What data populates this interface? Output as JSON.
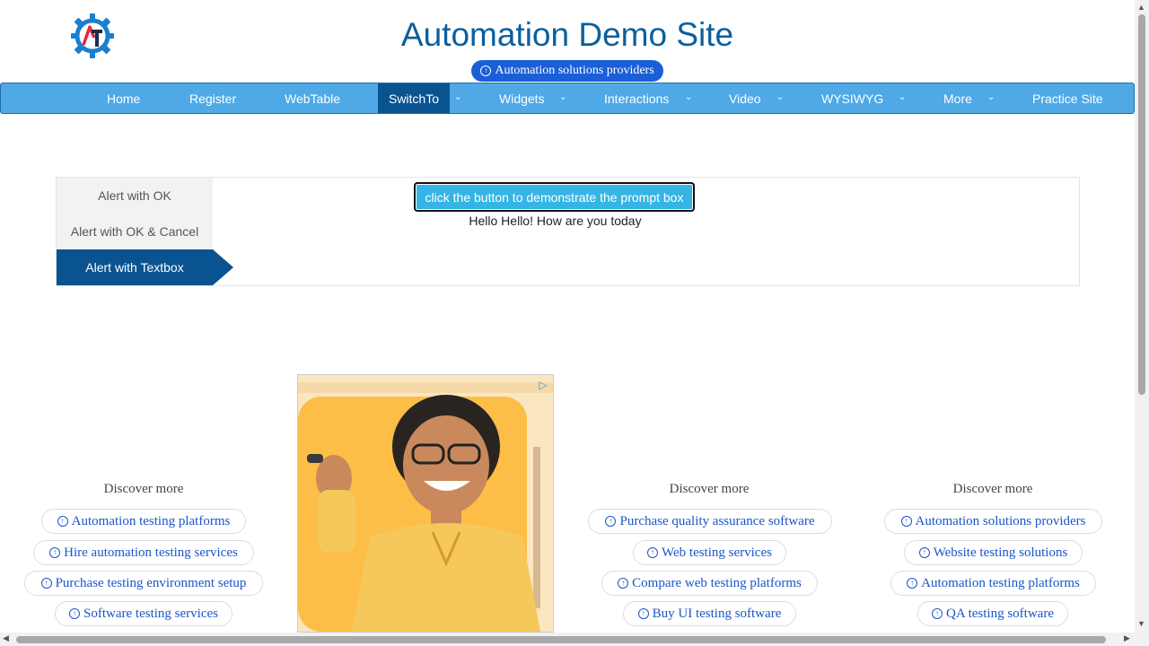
{
  "header": {
    "title": "Automation Demo Site",
    "promo": "Automation solutions providers"
  },
  "nav": {
    "items": [
      {
        "label": "Home"
      },
      {
        "label": "Register"
      },
      {
        "label": "WebTable"
      },
      {
        "label": "SwitchTo"
      },
      {
        "label": "Widgets"
      },
      {
        "label": "Interactions"
      },
      {
        "label": "Video"
      },
      {
        "label": "WYSIWYG"
      },
      {
        "label": "More"
      },
      {
        "label": "Practice Site"
      }
    ]
  },
  "alerts": {
    "tabs": [
      {
        "label": "Alert with OK"
      },
      {
        "label": "Alert with OK & Cancel"
      },
      {
        "label": "Alert with Textbox"
      }
    ],
    "button_label": "click the button to demonstrate the prompt box",
    "result": "Hello Hello! How are you today"
  },
  "discover": [
    {
      "title": "Discover more",
      "links": [
        "Automation testing platforms",
        "Hire automation testing services",
        "Purchase testing environment setup",
        "Software testing services"
      ]
    },
    {
      "title": "Discover more",
      "links": [
        "Purchase quality assurance software",
        "Web testing services",
        "Compare web testing platforms",
        "Buy UI testing software"
      ]
    },
    {
      "title": "Discover more",
      "links": [
        "Automation solutions providers",
        "Website testing solutions",
        "Automation testing platforms",
        "QA testing software"
      ]
    }
  ],
  "colors": {
    "brand": "#0a5f9e",
    "navbar": "#4fa9e6",
    "nav_active": "#0a5391",
    "button": "#35b5e5",
    "link": "#1a56c8"
  },
  "icons": {
    "logo": "gear-logo-icon",
    "link": "arrow-up-circle-icon",
    "dropdown": "chevron-down-icon",
    "ad": "adchoices-icon"
  }
}
